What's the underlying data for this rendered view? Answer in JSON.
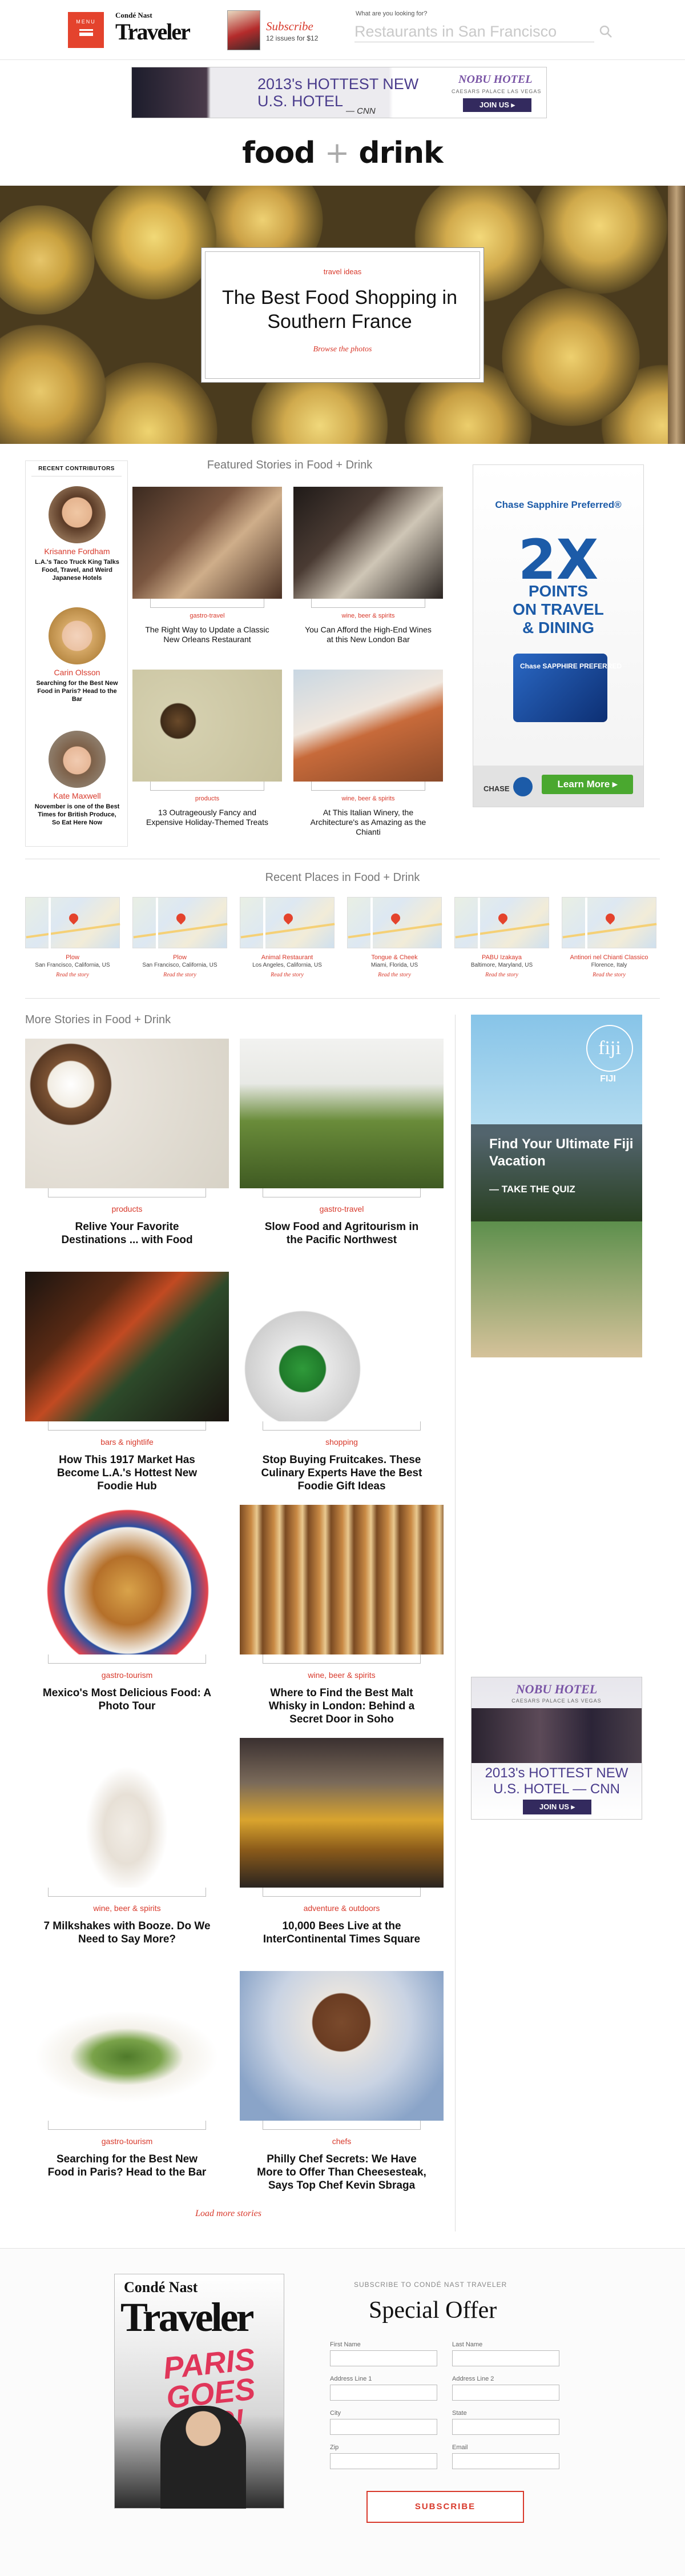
{
  "header": {
    "menu_label": "MENU",
    "logo_top": "Condé Nast",
    "logo_main": "Traveler",
    "subscribe_title": "Subscribe",
    "subscribe_price": "12 issues for $12",
    "search_hint": "What are you looking for?",
    "search_placeholder": "Restaurants in San Francisco"
  },
  "banner_ad": {
    "headline_line1": "2013's HOTTEST NEW",
    "headline_line2": "U.S. HOTEL",
    "source": "— CNN",
    "brand": "NOBU HOTEL",
    "brand_sub": "CAESARS PALACE LAS VEGAS",
    "cta": "JOIN US ▸"
  },
  "section": {
    "title_left": "food",
    "title_plus": "+",
    "title_right": "drink"
  },
  "hero": {
    "category": "travel ideas",
    "title": "The Best Food Shopping in Southern France",
    "cta": "Browse the photos"
  },
  "contributors": {
    "heading": "RECENT CONTRIBUTORS",
    "people": [
      {
        "name": "Krisanne Fordham",
        "desc": "L.A.'s Taco Truck King Talks Food, Travel, and Weird Japanese Hotels"
      },
      {
        "name": "Carin Olsson",
        "desc": "Searching for the Best New Food in Paris? Head to the Bar"
      },
      {
        "name": "Kate Maxwell",
        "desc": "November is one of the Best Times for British Produce, So Eat Here Now"
      }
    ]
  },
  "featured": {
    "heading": "Featured Stories in Food + Drink",
    "items": [
      {
        "category": "gastro-travel",
        "title": "The Right Way to Update a Classic New Orleans Restaurant"
      },
      {
        "category": "wine, beer & spirits",
        "title": "You Can Afford the High-End Wines at this New London Bar"
      },
      {
        "category": "products",
        "title": "13 Outrageously Fancy and Expensive Holiday-Themed Treats"
      },
      {
        "category": "wine, beer & spirits",
        "title": "At This Italian Winery, the Architecture's as Amazing as the Chianti"
      }
    ]
  },
  "chase_ad": {
    "brand": "Chase Sapphire Preferred®",
    "big": "2X",
    "line1": "POINTS",
    "line2": "ON TRAVEL",
    "line3": "& DINING",
    "card_label": "Chase SAPPHIRE PREFERRED",
    "footer_logo": "CHASE",
    "cta": "Learn More ▸"
  },
  "places": {
    "heading": "Recent Places in Food + Drink",
    "items": [
      {
        "name": "Plow",
        "address": "San Francisco, California, US",
        "link": "Read the story"
      },
      {
        "name": "Plow",
        "address": "San Francisco, California, US",
        "link": "Read the story"
      },
      {
        "name": "Animal Restaurant",
        "address": "Los Angeles, California, US",
        "link": "Read the story"
      },
      {
        "name": "Tongue & Cheek",
        "address": "Miami, Florida, US",
        "link": "Read the story"
      },
      {
        "name": "PABU Izakaya",
        "address": "Baltimore, Maryland, US",
        "link": "Read the story"
      },
      {
        "name": "Antinori nel Chianti Classico",
        "address": "Florence, Italy",
        "link": "Read the story"
      }
    ]
  },
  "more": {
    "heading": "More Stories in Food + Drink",
    "items": [
      {
        "category": "products",
        "title": "Relive Your Favorite Destinations ... with Food"
      },
      {
        "category": "gastro-travel",
        "title": "Slow Food and Agritourism in the Pacific Northwest"
      },
      {
        "category": "bars & nightlife",
        "title": "How This 1917 Market Has Become L.A.'s Hottest New Foodie Hub"
      },
      {
        "category": "shopping",
        "title": "Stop Buying Fruitcakes. These Culinary Experts Have the Best Foodie Gift Ideas"
      },
      {
        "category": "gastro-tourism",
        "title": "Mexico's Most Delicious Food: A Photo Tour"
      },
      {
        "category": "wine, beer & spirits",
        "title": "Where to Find the Best Malt Whisky in London: Behind a Secret Door in Soho"
      },
      {
        "category": "wine, beer & spirits",
        "title": "7 Milkshakes with Booze. Do We Need to Say More?"
      },
      {
        "category": "adventure & outdoors",
        "title": "10,000 Bees Live at the InterContinental Times Square"
      },
      {
        "category": "gastro-tourism",
        "title": "Searching for the Best New Food in Paris? Head to the Bar"
      },
      {
        "category": "chefs",
        "title": "Philly Chef Secrets: We Have More to Offer Than Cheesesteak, Says Top Chef Kevin Sbraga"
      }
    ],
    "load_more": "Load more stories"
  },
  "fiji_ad": {
    "logo": "fiji",
    "tagline": "FIJI",
    "headline": "Find Your Ultimate Fiji Vacation",
    "cta": "— TAKE THE QUIZ"
  },
  "nobu_ad": {
    "brand": "NOBU HOTEL",
    "brand_sub": "CAESARS PALACE LAS VEGAS",
    "headline_line1": "2013's HOTTEST NEW",
    "headline_line2": "U.S. HOTEL — CNN",
    "cta": "JOIN US ▸"
  },
  "footer": {
    "mag_top": "Condé Nast",
    "mag_main": "Traveler",
    "mag_cover": "PARIS GOES POP!",
    "kicker": "SUBSCRIBE TO CONDÉ NAST TRAVELER",
    "title": "Special Offer",
    "labels": {
      "first_name": "First Name",
      "last_name": "Last Name",
      "address1": "Address Line 1",
      "address2": "Address Line 2",
      "city": "City",
      "state": "State",
      "zip": "Zip",
      "email": "Email"
    },
    "cta": "SUBSCRIBE"
  },
  "colors": {
    "accent": "#d8392b",
    "menu": "#e4432d",
    "chase_blue": "#1c5ba8",
    "nobu_purple": "#4a3c8c"
  }
}
